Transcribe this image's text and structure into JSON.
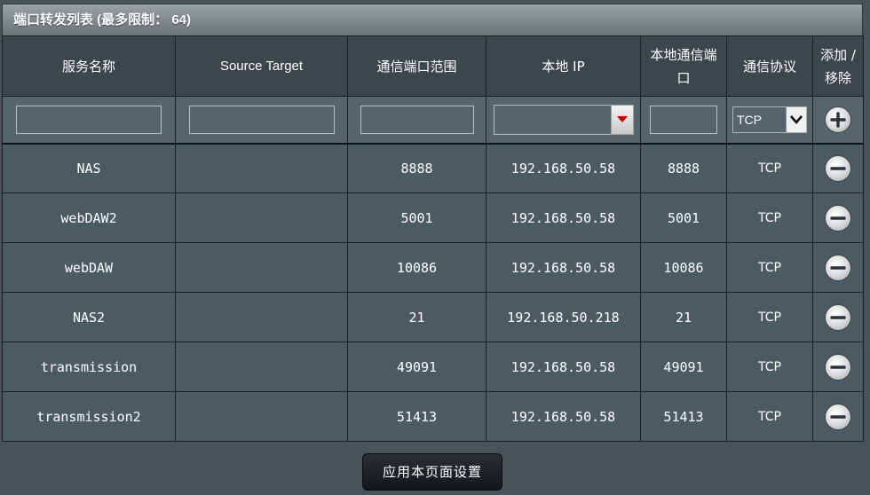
{
  "panel": {
    "title": "端口转发列表 (最多限制： 64)"
  },
  "columns": [
    {
      "label": "服务名称"
    },
    {
      "label": "Source Target"
    },
    {
      "label": "通信端口范围"
    },
    {
      "label": "本地 IP"
    },
    {
      "label": "本地通信端口"
    },
    {
      "label": "通信协议"
    },
    {
      "label": "添加 / 移除"
    }
  ],
  "new_entry": {
    "service_name": "",
    "source_target": "",
    "port_range": "",
    "local_ip": "",
    "local_port": "",
    "protocol": "TCP"
  },
  "rules": [
    {
      "service": "NAS",
      "source": "",
      "port_range": "8888",
      "local_ip": "192.168.50.58",
      "local_port": "8888",
      "protocol": "TCP"
    },
    {
      "service": "webDAW2",
      "source": "",
      "port_range": "5001",
      "local_ip": "192.168.50.58",
      "local_port": "5001",
      "protocol": "TCP"
    },
    {
      "service": "webDAW",
      "source": "",
      "port_range": "10086",
      "local_ip": "192.168.50.58",
      "local_port": "10086",
      "protocol": "TCP"
    },
    {
      "service": "NAS2",
      "source": "",
      "port_range": "21",
      "local_ip": "192.168.50.218",
      "local_port": "21",
      "protocol": "TCP"
    },
    {
      "service": "transmission",
      "source": "",
      "port_range": "49091",
      "local_ip": "192.168.50.58",
      "local_port": "49091",
      "protocol": "TCP"
    },
    {
      "service": "transmission2",
      "source": "",
      "port_range": "51413",
      "local_ip": "192.168.50.58",
      "local_port": "51413",
      "protocol": "TCP"
    }
  ],
  "footer": {
    "apply_label": "应用本页面设置"
  },
  "icons": {
    "add": "plus-circle-icon",
    "remove": "minus-circle-icon",
    "dropdown": "chevron-down-icon"
  },
  "colors": {
    "background": "#4a5358",
    "header_bg": "#3d464b",
    "row_bg": "#4c5a61",
    "dropdown_arrow": "#c00000"
  }
}
